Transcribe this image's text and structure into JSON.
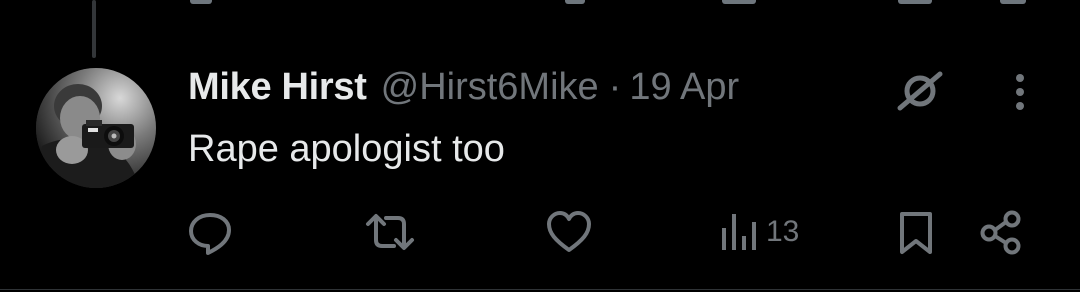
{
  "tweet": {
    "display_name": "Mike Hirst",
    "handle": "@Hirst6Mike",
    "separator": "·",
    "date": "19 Apr",
    "text": "Rape apologist too"
  },
  "actions": {
    "reply_icon": "reply-icon",
    "retweet_icon": "retweet-icon",
    "like_icon": "heart-icon",
    "views_icon": "analytics-icon",
    "views_count": "13",
    "bookmark_icon": "bookmark-icon",
    "share_icon": "share-icon"
  },
  "colors": {
    "background": "#000000",
    "primary_text": "#e7e9ea",
    "secondary_text": "#71767b",
    "border": "#2f3336"
  }
}
